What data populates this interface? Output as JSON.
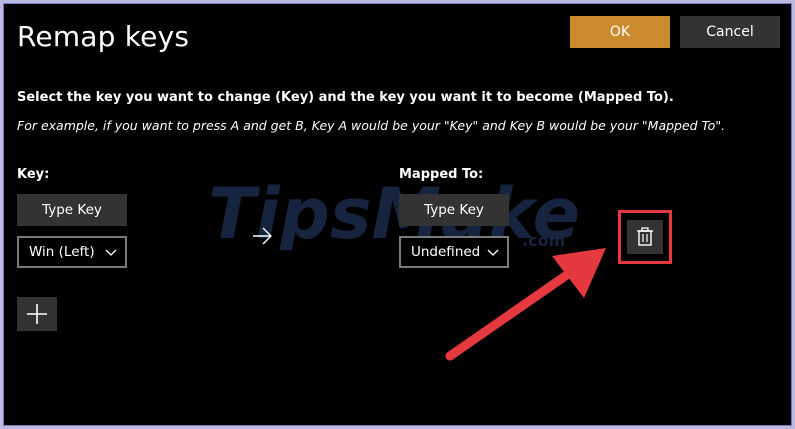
{
  "window": {
    "title": "Remap keys",
    "ok_label": "OK",
    "cancel_label": "Cancel"
  },
  "instructions": {
    "primary": "Select the key you want to change (Key) and the key you want it to become (Mapped To).",
    "example": "For example, if you want to press A and get B, Key A would be your \"Key\" and Key B would be your \"Mapped To\"."
  },
  "mapping": {
    "key_label": "Key:",
    "mapped_label": "Mapped To:",
    "type_key_label": "Type Key",
    "rows": [
      {
        "key_value": "Win (Left)",
        "mapped_value": "Undefined"
      }
    ]
  },
  "icons": {
    "arrow": "arrow-right-icon",
    "add": "plus-icon",
    "delete": "trash-icon",
    "dropdown": "chevron-down-icon"
  },
  "colors": {
    "accent": "#cc8a2e",
    "button_bg": "#333333",
    "highlight": "#e5393f",
    "window_bg": "#000000",
    "frame": "#b9b9df"
  },
  "watermark": "TipsMake.com"
}
